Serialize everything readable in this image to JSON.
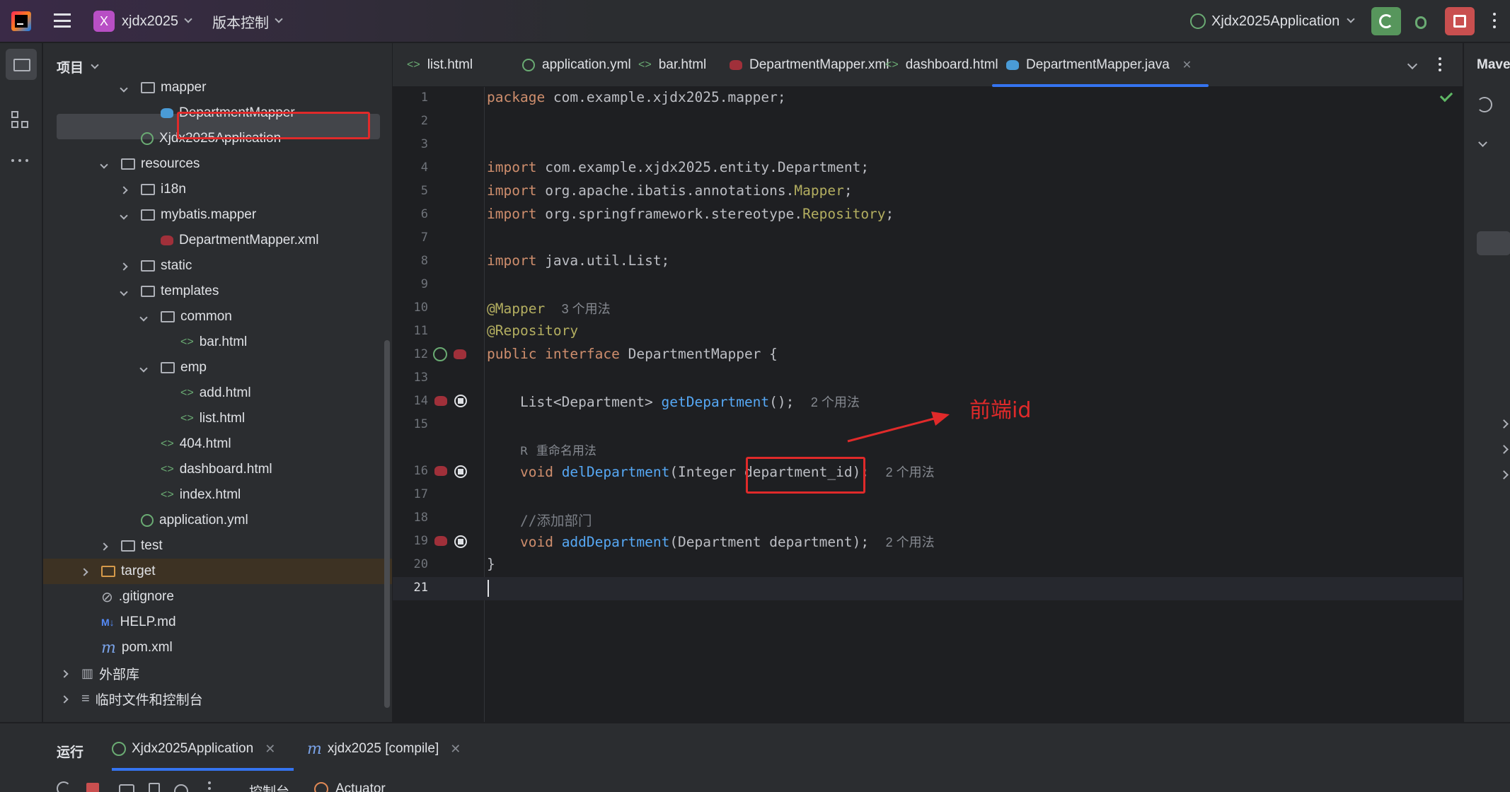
{
  "titlebar": {
    "project_badge": "X",
    "project_name": "xjdx2025",
    "vcs": "版本控制",
    "run_config": "Xjdx2025Application"
  },
  "project_panel": {
    "title": "项目",
    "tree": [
      {
        "label": "mapper",
        "kind": "folder",
        "expanded": true
      },
      {
        "label": "DepartmentMapper",
        "kind": "mapper-java",
        "selected": true
      },
      {
        "label": "Xjdx2025Application",
        "kind": "spring-class"
      },
      {
        "label": "resources",
        "kind": "folder",
        "expanded": true
      },
      {
        "label": "i18n",
        "kind": "folder",
        "expanded": false
      },
      {
        "label": "mybatis.mapper",
        "kind": "folder",
        "expanded": true
      },
      {
        "label": "DepartmentMapper.xml",
        "kind": "mapper-xml"
      },
      {
        "label": "static",
        "kind": "folder",
        "expanded": false
      },
      {
        "label": "templates",
        "kind": "folder",
        "expanded": true
      },
      {
        "label": "common",
        "kind": "folder",
        "expanded": true
      },
      {
        "label": "bar.html",
        "kind": "html"
      },
      {
        "label": "emp",
        "kind": "folder",
        "expanded": true
      },
      {
        "label": "add.html",
        "kind": "html"
      },
      {
        "label": "list.html",
        "kind": "html"
      },
      {
        "label": "404.html",
        "kind": "html"
      },
      {
        "label": "dashboard.html",
        "kind": "html"
      },
      {
        "label": "index.html",
        "kind": "html"
      },
      {
        "label": "application.yml",
        "kind": "yml"
      },
      {
        "label": "test",
        "kind": "folder",
        "expanded": false
      },
      {
        "label": "target",
        "kind": "folder-orange",
        "expanded": false
      },
      {
        "label": ".gitignore",
        "kind": "ignore"
      },
      {
        "label": "HELP.md",
        "kind": "md"
      },
      {
        "label": "pom.xml",
        "kind": "maven"
      },
      {
        "label": "外部库",
        "kind": "library",
        "expanded": false
      },
      {
        "label": "临时文件和控制台",
        "kind": "scratch",
        "expanded": false
      }
    ]
  },
  "tabs": [
    {
      "label": "list.html",
      "icon": "html-icon"
    },
    {
      "label": "application.yml",
      "icon": "yml-icon"
    },
    {
      "label": "bar.html",
      "icon": "html-icon"
    },
    {
      "label": "DepartmentMapper.xml",
      "icon": "mybatis-icon"
    },
    {
      "label": "dashboard.html",
      "icon": "html-icon"
    },
    {
      "label": "DepartmentMapper.java",
      "icon": "mapper-icon",
      "active": true
    }
  ],
  "code": {
    "line_numbers": [
      "1",
      "2",
      "3",
      "4",
      "5",
      "6",
      "7",
      "8",
      "9",
      "10",
      "11",
      "12",
      "13",
      "14",
      "15",
      "16",
      "17",
      "18",
      "19",
      "20",
      "21"
    ],
    "l1_kw": "package",
    "l1_rest": " com.example.xjdx2025.mapper;",
    "l4_kw": "import",
    "l4_rest": " com.example.xjdx2025.entity.Department;",
    "l5_kw": "import",
    "l5_rest": " org.apache.ibatis.annotations.",
    "l5_ann": "Mapper",
    "l5_end": ";",
    "l6_kw": "import",
    "l6_rest": " org.springframework.stereotype.",
    "l6_ann": "Repository",
    "l6_end": ";",
    "l8_kw": "import",
    "l8_rest": " java.util.List;",
    "l10_ann": "@Mapper",
    "l10_hint": "3 个用法",
    "l11_ann": "@Repository",
    "l12_kw": "public interface",
    "l12_rest": " DepartmentMapper {",
    "l14_pre": "    List<Department> ",
    "l14_fn": "getDepartment",
    "l14_end": "();",
    "l14_hint": "2 个用法",
    "rename_hint": "重命名用法",
    "l16_pre": "    ",
    "l16_kw": "void",
    "l16_sp": " ",
    "l16_fn": "delDepartment",
    "l16_mid": "(Integer ",
    "l16_param": "department_id",
    "l16_end": ");",
    "l16_hint": "2 个用法",
    "l18_cm": "    //添加部门",
    "l19_pre": "    ",
    "l19_kw": "void",
    "l19_sp": " ",
    "l19_fn": "addDepartment",
    "l19_end": "(Department department);",
    "l19_hint": "2 个用法",
    "l20": "}"
  },
  "annotation": {
    "label": "前端id",
    "color": "#e02a2a"
  },
  "right_panel": {
    "title": "Mave"
  },
  "bottom": {
    "title": "运行",
    "tab1": "Xjdx2025Application",
    "tab2": "xjdx2025 [compile]",
    "console": "控制台",
    "actuator": "Actuator"
  },
  "colors": {
    "accent": "#3574f0",
    "highlight": "#e02a2a",
    "run_green": "#57965c",
    "stop_red": "#c94f4f"
  }
}
